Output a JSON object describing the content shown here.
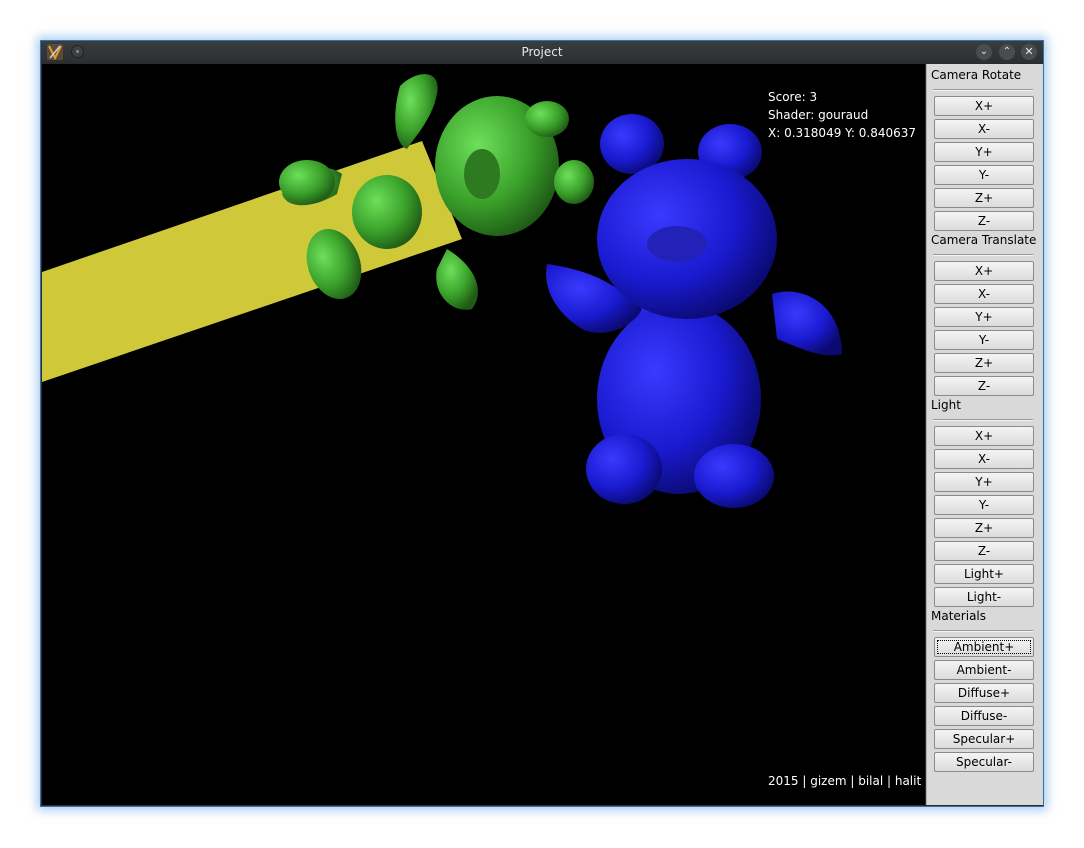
{
  "window": {
    "title": "Project"
  },
  "hud": {
    "score": "Score: 3",
    "shader": "Shader: gouraud",
    "coords": "X: 0.318049 Y: 0.840637",
    "credits": "2015 | gizem | bilal | halit"
  },
  "scene": {
    "objects": [
      "yellow-beam",
      "green-bear",
      "blue-bear"
    ],
    "colors": {
      "yellow": "#cfc93a",
      "green": "#3aa02a",
      "blue": "#1a1ad0"
    }
  },
  "panel": {
    "camera_rotate": {
      "label": "Camera Rotate",
      "buttons": [
        "X+",
        "X-",
        "Y+",
        "Y-",
        "Z+",
        "Z-"
      ]
    },
    "camera_translate": {
      "label": "Camera Translate",
      "buttons": [
        "X+",
        "X-",
        "Y+",
        "Y-",
        "Z+",
        "Z-"
      ]
    },
    "light": {
      "label": "Light",
      "buttons": [
        "X+",
        "X-",
        "Y+",
        "Y-",
        "Z+",
        "Z-",
        "Light+",
        "Light-"
      ]
    },
    "materials": {
      "label": "Materials",
      "buttons": [
        "Ambient+",
        "Ambient-",
        "Diffuse+",
        "Diffuse-",
        "Specular+",
        "Specular-"
      ]
    }
  }
}
